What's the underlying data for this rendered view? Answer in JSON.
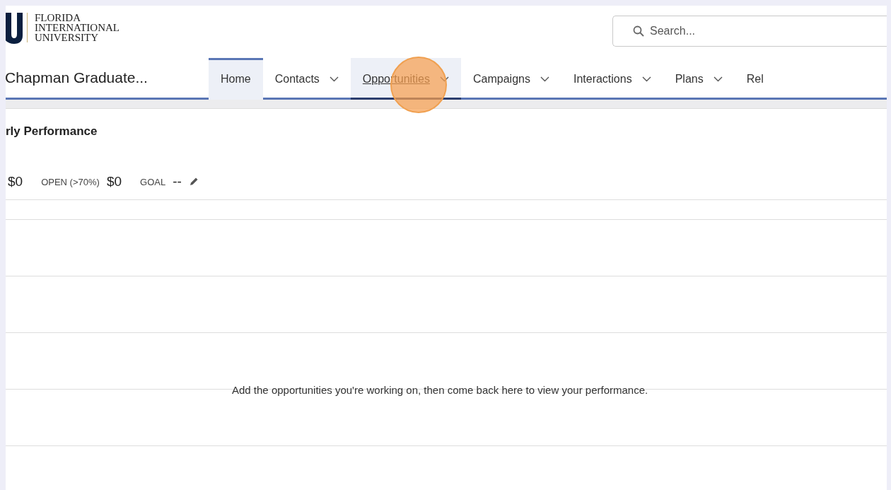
{
  "logo": {
    "lines": [
      "FLORIDA",
      "INTERNATIONAL",
      "UNIVERSITY"
    ]
  },
  "search": {
    "placeholder": "Search..."
  },
  "app_name": "Chapman Graduate...",
  "tabs": [
    {
      "label": "Home",
      "kind": "plain",
      "selected": true,
      "active": false,
      "clicked": false
    },
    {
      "label": "Contacts",
      "kind": "menu",
      "selected": false,
      "active": false,
      "clicked": false
    },
    {
      "label": "Opportunities",
      "kind": "menu",
      "selected": false,
      "active": true,
      "clicked": true
    },
    {
      "label": "Campaigns",
      "kind": "menu",
      "selected": false,
      "active": false,
      "clicked": false
    },
    {
      "label": "Interactions",
      "kind": "menu",
      "selected": false,
      "active": false,
      "clicked": false
    },
    {
      "label": "Plans",
      "kind": "menu",
      "selected": false,
      "active": false,
      "clicked": false
    },
    {
      "label": "Rel",
      "kind": "plain",
      "selected": false,
      "active": false,
      "clicked": false
    }
  ],
  "performance": {
    "title": "rly Performance",
    "metrics": [
      {
        "value": "$0"
      },
      {
        "label": "OPEN (>70%)",
        "value": "$0"
      },
      {
        "label": "GOAL",
        "value": "--",
        "editable": true
      }
    ],
    "empty_message": "Add the opportunities you're working on, then come back here to view your performance."
  }
}
